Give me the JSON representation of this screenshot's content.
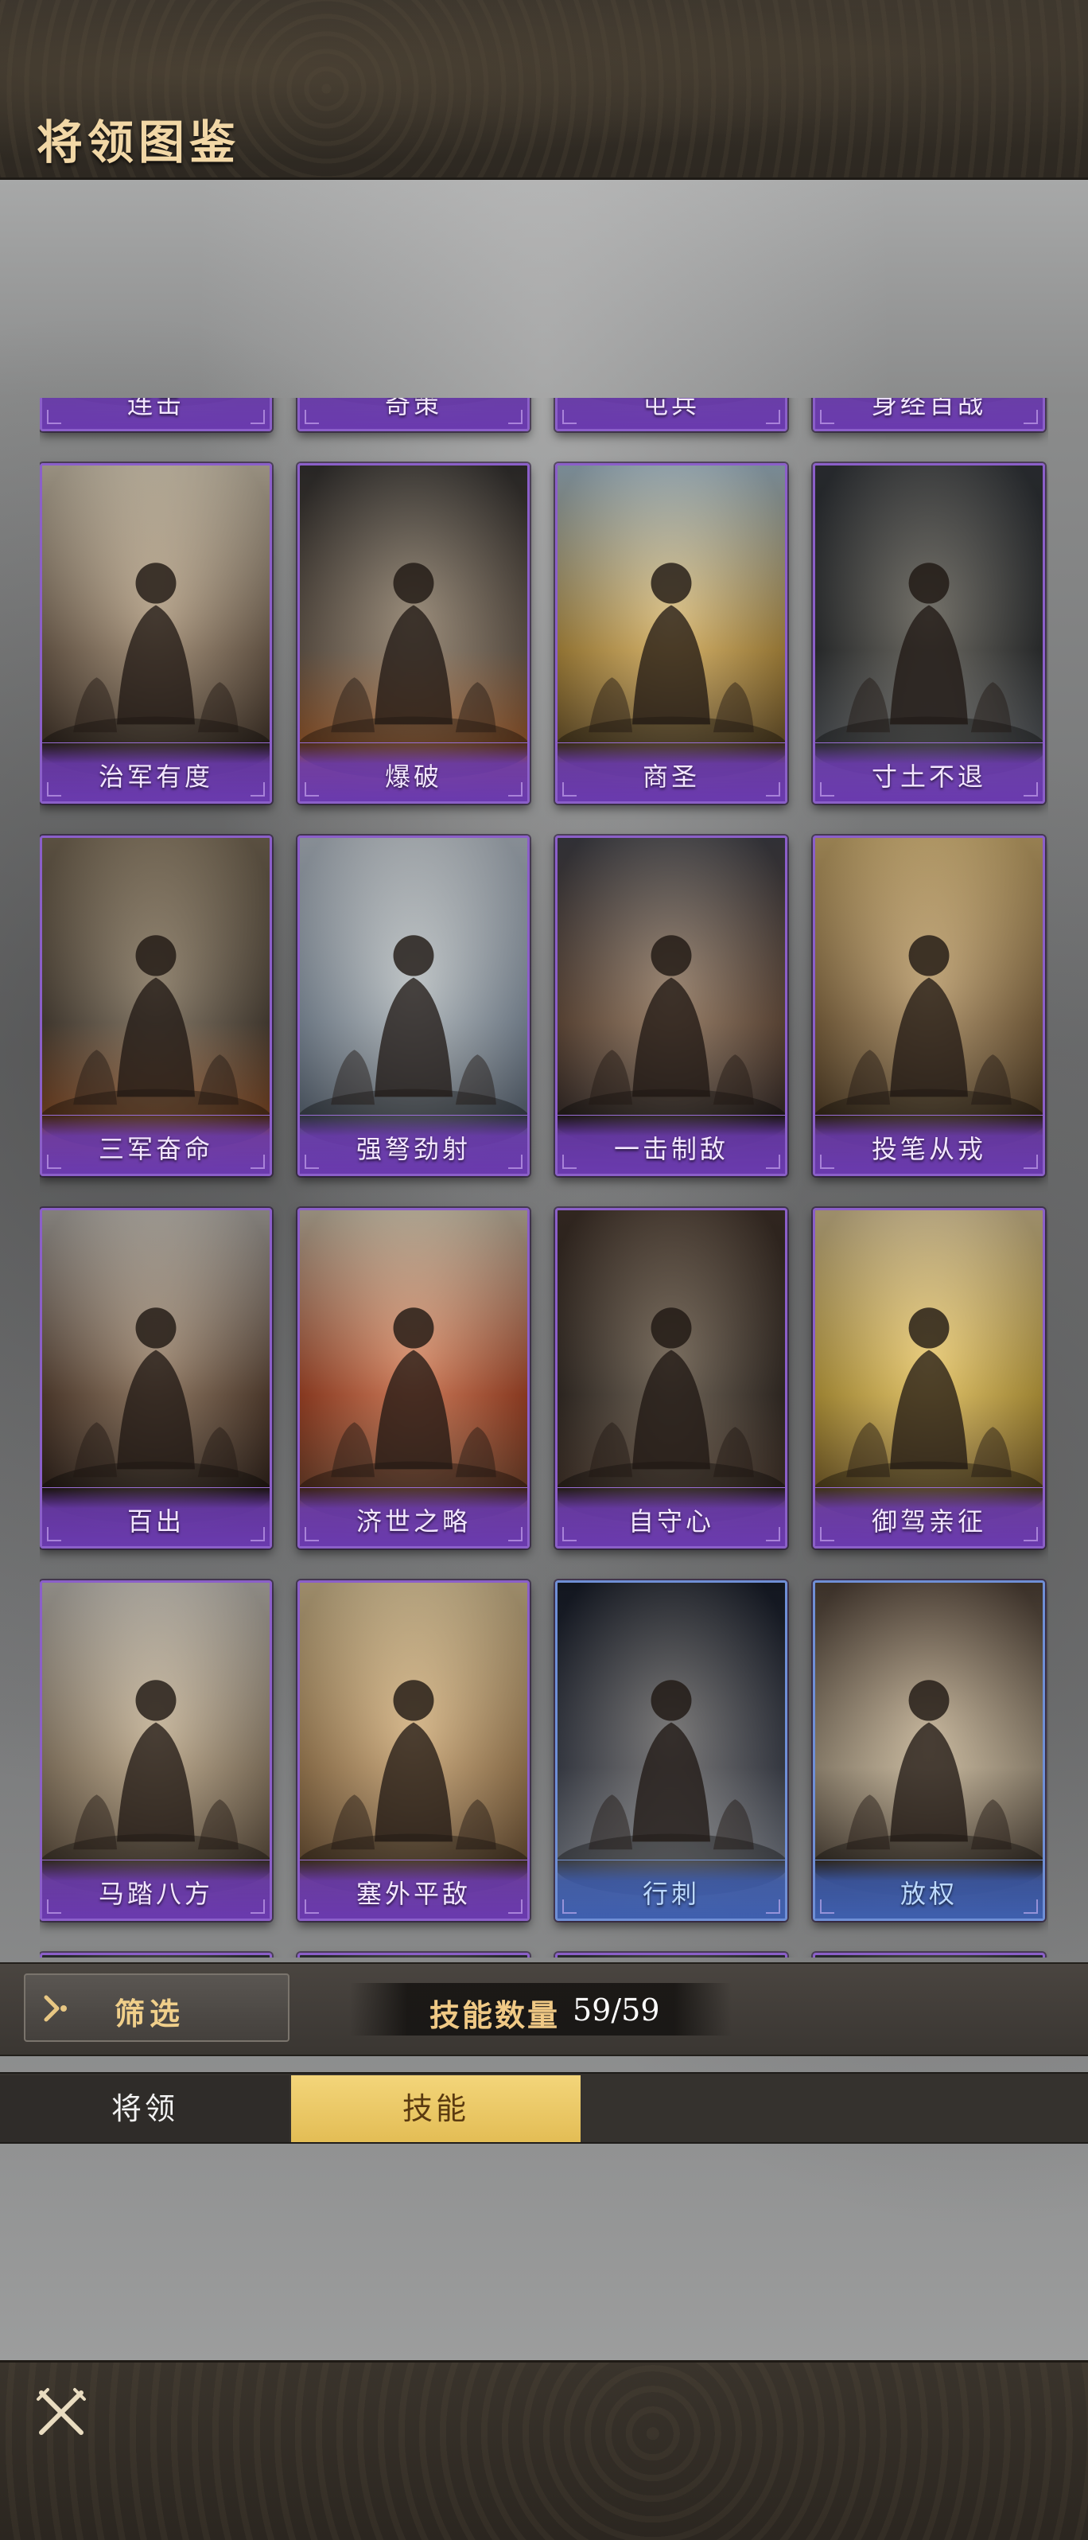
{
  "header": {
    "title": "将领图鉴"
  },
  "partial_row": [
    "连击",
    "奇策",
    "屯兵",
    "身经百战"
  ],
  "cards": [
    {
      "name": "治军有度",
      "style": "purple",
      "scene": "command"
    },
    {
      "name": "爆破",
      "style": "purple",
      "scene": "explosion"
    },
    {
      "name": "商圣",
      "style": "purple",
      "scene": "merchant"
    },
    {
      "name": "寸土不退",
      "style": "purple",
      "scene": "army"
    },
    {
      "name": "三军奋命",
      "style": "purple",
      "scene": "charge"
    },
    {
      "name": "强弩劲射",
      "style": "purple",
      "scene": "crossbow"
    },
    {
      "name": "一击制敌",
      "style": "purple",
      "scene": "duel"
    },
    {
      "name": "投笔从戎",
      "style": "purple",
      "scene": "rider"
    },
    {
      "name": "百出",
      "style": "purple",
      "scene": "throne"
    },
    {
      "name": "济世之略",
      "style": "purple",
      "scene": "strategist"
    },
    {
      "name": "自守心",
      "style": "purple",
      "scene": "door"
    },
    {
      "name": "御驾亲征",
      "style": "purple",
      "scene": "emperor"
    },
    {
      "name": "马踏八方",
      "style": "purple",
      "scene": "cavalry"
    },
    {
      "name": "塞外平敌",
      "style": "purple",
      "scene": "desert"
    },
    {
      "name": "行刺",
      "style": "blue",
      "scene": "assassin"
    },
    {
      "name": "放权",
      "style": "blue",
      "scene": "official"
    }
  ],
  "filter": {
    "label": "筛选",
    "icon": "chevron-right-icon"
  },
  "skill_count": {
    "label": "技能数量",
    "value": "59/59"
  },
  "tabs": [
    {
      "label": "将领",
      "active": false
    },
    {
      "label": "技能",
      "active": true
    }
  ],
  "footer": {
    "close_icon": "crossed-swords-close-icon"
  },
  "colors": {
    "card_purple": "#8b5fc9",
    "card_blue": "#6f8fd6",
    "gold_text": "#f0cf8a",
    "tab_active": "#e9c663"
  }
}
